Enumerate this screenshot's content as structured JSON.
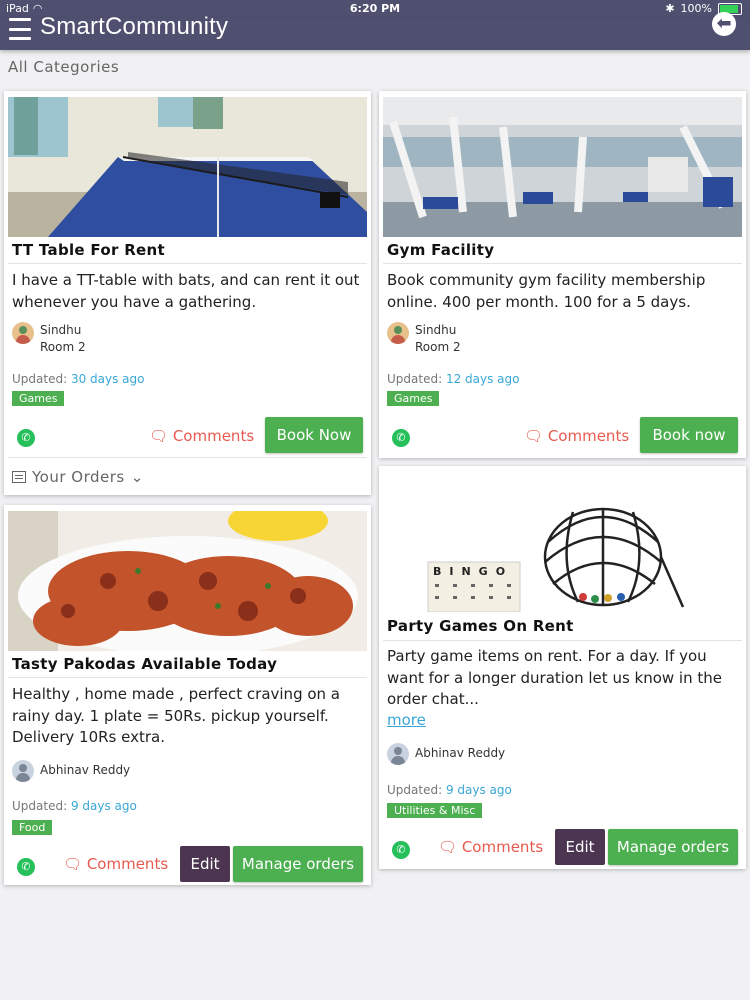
{
  "status": {
    "device": "iPad",
    "time": "6:20 PM",
    "battery": "100%"
  },
  "header": {
    "title": "SmartCommunity"
  },
  "page": {
    "section_title": "All Categories"
  },
  "cards": [
    {
      "title": "TT Table For Rent",
      "description": "I have a TT-table with bats, and can rent it out whenever you have a gathering.",
      "author": "Sindhu",
      "room": "Room 2",
      "updated_label": "Updated:",
      "updated_ago": "30 days ago",
      "tag": "Games",
      "comments_label": "Comments",
      "primary_button": "Book Now",
      "orders_label": "Your Orders"
    },
    {
      "title": "Gym Facility",
      "description": "Book community gym facility membership online. 400 per month. 100 for a 5 days.",
      "author": "Sindhu",
      "room": "Room 2",
      "updated_label": "Updated:",
      "updated_ago": "12 days ago",
      "tag": "Games",
      "comments_label": "Comments",
      "primary_button": "Book now"
    },
    {
      "title": "Tasty Pakodas Available Today",
      "description": "Healthy , home made , perfect craving on a rainy day. 1 plate = 50Rs. pickup yourself. Delivery 10Rs extra.",
      "author": "Abhinav Reddy",
      "updated_label": "Updated:",
      "updated_ago": "9 days ago",
      "tag": "Food",
      "comments_label": "Comments",
      "edit_button": "Edit",
      "manage_button": "Manage orders"
    },
    {
      "title": "Party Games On Rent",
      "description": "Party game items on rent. For a day. If you want for a longer duration let us know in the order chat...",
      "more_label": "more",
      "author": "Abhinav Reddy",
      "updated_label": "Updated:",
      "updated_ago": "9 days ago",
      "tag": "Utilities & Misc",
      "comments_label": "Comments",
      "edit_button": "Edit",
      "manage_button": "Manage orders",
      "image_text": "BINGO"
    }
  ],
  "colors": {
    "navbar": "#4f4f6f",
    "green": "#4caf50",
    "purple": "#4c3550",
    "comments": "#e8594f",
    "link": "#39a7d6"
  },
  "icons": {
    "menu": "hamburger-icon",
    "back": "back-arrow-icon",
    "comments": "comment-icon",
    "whatsapp": "whatsapp-icon",
    "orders": "list-icon",
    "chevron": "chevron-down-icon"
  }
}
